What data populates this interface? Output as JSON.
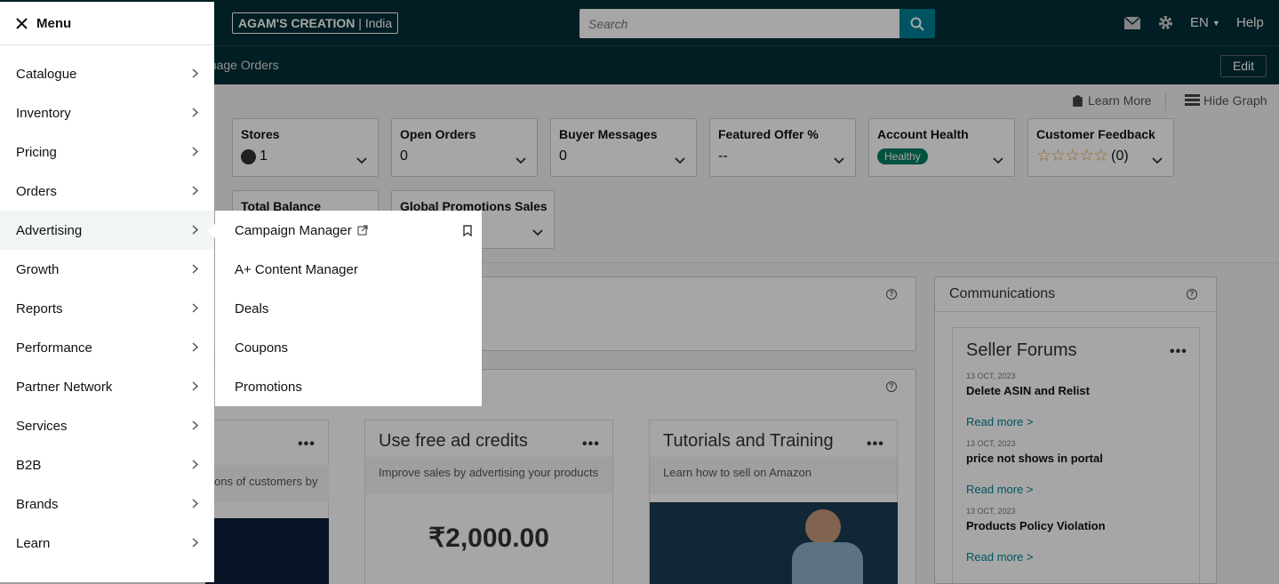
{
  "header": {
    "store_name": "AGAM'S CREATION",
    "store_region": "India",
    "search_placeholder": "Search",
    "language": "EN",
    "help": "Help"
  },
  "subnav": {
    "text": "anage Orders",
    "edit": "Edit"
  },
  "graph_links": {
    "learn_more": "Learn More",
    "hide_graph": "Hide Graph"
  },
  "metrics": {
    "stores": {
      "label": "Stores",
      "value": "1"
    },
    "open_orders": {
      "label": "Open Orders",
      "value": "0"
    },
    "buyer_messages": {
      "label": "Buyer Messages",
      "value": "0"
    },
    "featured_offer": {
      "label": "Featured Offer %",
      "value": "--"
    },
    "account_health": {
      "label": "Account Health",
      "value": "Healthy"
    },
    "customer_feedback": {
      "label": "Customer Feedback",
      "value": "(0)",
      "rating": 0
    },
    "total_balance": {
      "label": "Total Balance"
    },
    "global_promotions": {
      "label": "Global Promotions Sales"
    }
  },
  "communications": {
    "title": "Communications",
    "forums_title": "Seller Forums",
    "posts": [
      {
        "date": "13 OCT, 2023",
        "title": "Delete ASIN and Relist",
        "link": "Read more >"
      },
      {
        "date": "13 OCT, 2023",
        "title": "price not shows in portal",
        "link": "Read more >"
      },
      {
        "date": "13 OCT, 2023",
        "title": "Products Policy Violation",
        "link": "Read more >"
      }
    ]
  },
  "cards": {
    "first_desc": "ons of customers by",
    "ad_credits": {
      "title": "Use free ad credits",
      "desc": "Improve sales by advertising your products",
      "amount": "₹2,000.00"
    },
    "tutorials": {
      "title": "Tutorials and Training",
      "desc": "Learn how to sell on Amazon"
    }
  },
  "menu": {
    "title": "Menu",
    "items": [
      {
        "label": "Catalogue"
      },
      {
        "label": "Inventory"
      },
      {
        "label": "Pricing"
      },
      {
        "label": "Orders"
      },
      {
        "label": "Advertising"
      },
      {
        "label": "Growth"
      },
      {
        "label": "Reports"
      },
      {
        "label": "Performance"
      },
      {
        "label": "Partner Network"
      },
      {
        "label": "Services"
      },
      {
        "label": "B2B"
      },
      {
        "label": "Brands"
      },
      {
        "label": "Learn"
      }
    ]
  },
  "submenu": {
    "items": [
      {
        "label": "Campaign Manager"
      },
      {
        "label": "A+ Content Manager"
      },
      {
        "label": "Deals"
      },
      {
        "label": "Coupons"
      },
      {
        "label": "Promotions"
      }
    ]
  },
  "colors": {
    "header_bg": "#002f36",
    "accent": "#008296",
    "healthy": "#067d62"
  }
}
